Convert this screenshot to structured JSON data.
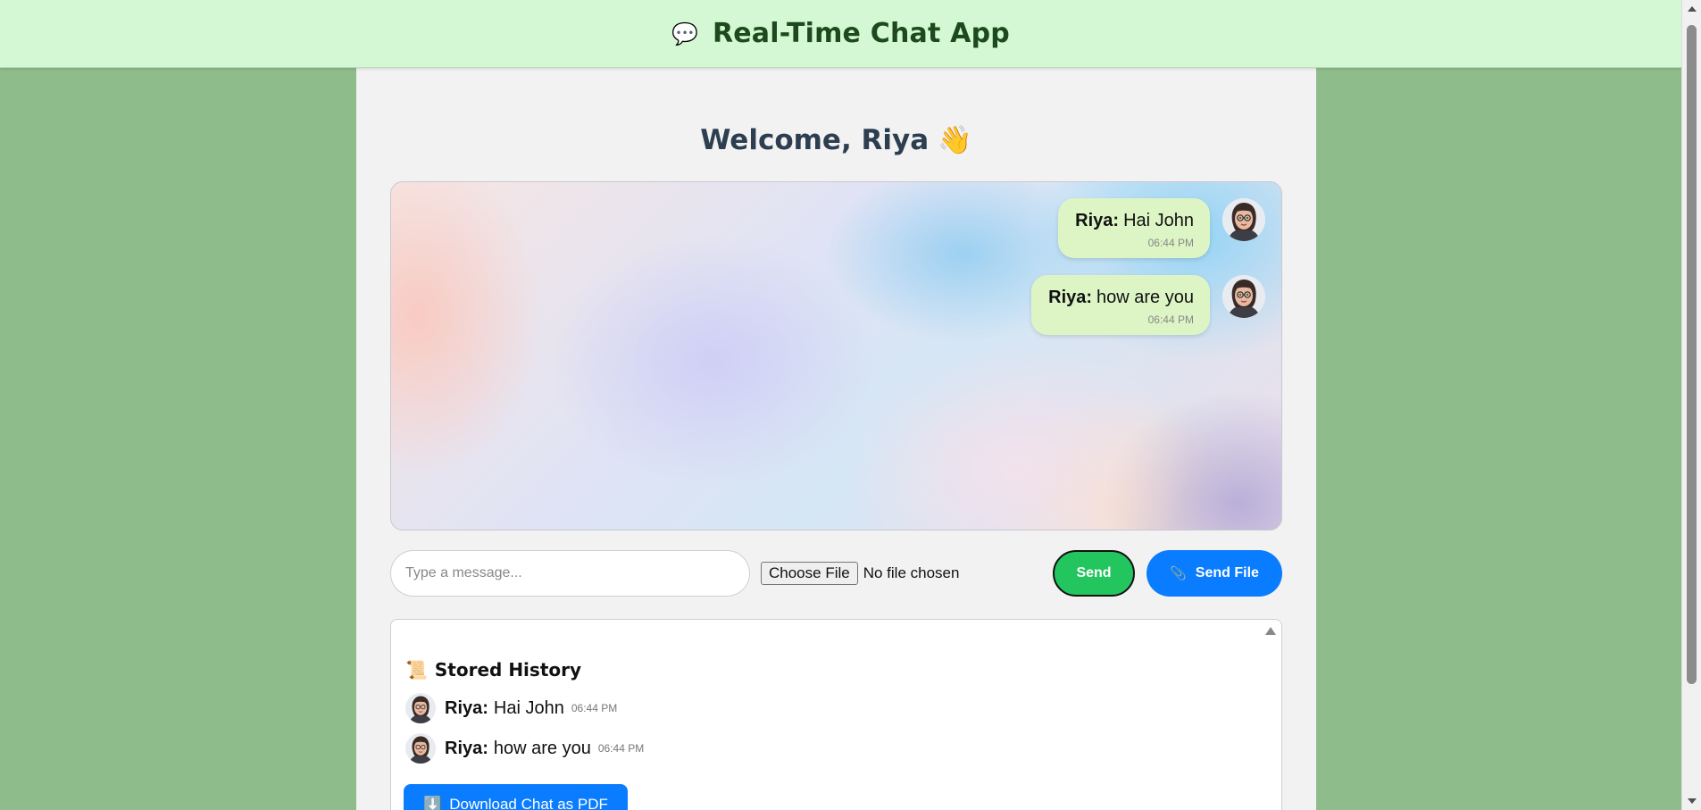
{
  "header": {
    "icon": "speech-bubble-icon",
    "icon_glyph": "💬",
    "title": "Real-Time Chat App"
  },
  "welcome": {
    "text": "Welcome, Riya",
    "emoji": "👋"
  },
  "messages": [
    {
      "sender": "Riya:",
      "text": "Hai John",
      "time": "06:44 PM",
      "avatar": "user-avatar"
    },
    {
      "sender": "Riya:",
      "text": "how are you",
      "time": "06:44 PM",
      "avatar": "user-avatar"
    }
  ],
  "composer": {
    "placeholder": "Type a message...",
    "choose_file_label": "Choose File",
    "file_status": "No file chosen",
    "send_label": "Send",
    "send_file_label": "Send File",
    "send_file_icon": "📎"
  },
  "history": {
    "title": "Stored History",
    "icon": "scroll-icon",
    "icon_glyph": "📜",
    "items": [
      {
        "sender": "Riya:",
        "text": "Hai John",
        "time": "06:44 PM"
      },
      {
        "sender": "Riya:",
        "text": "how are you",
        "time": "06:44 PM"
      }
    ],
    "download_label": "Download Chat as PDF",
    "download_icon": "⬇️"
  },
  "colors": {
    "header_bg": "#d4f7d4",
    "page_bg": "#8fbc8b",
    "bubble_bg": "#ddf5c5",
    "send_btn": "#22c55e",
    "primary_btn": "#0a7cff"
  }
}
